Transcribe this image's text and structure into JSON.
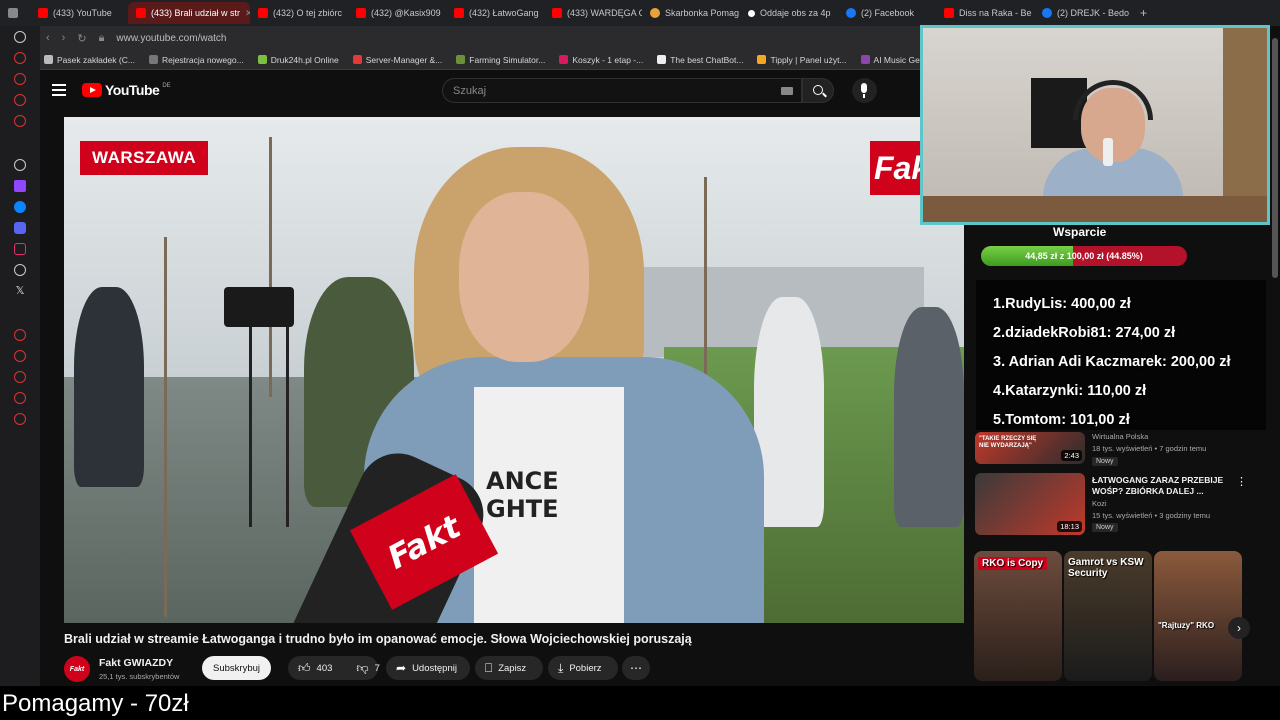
{
  "browser": {
    "tabs": [
      {
        "label": "(433) YouTube",
        "icon": "youtube-icon"
      },
      {
        "label": "(433) Brali udział w str",
        "icon": "youtube-icon",
        "active": true
      },
      {
        "label": "(432) O tej zbiórc",
        "icon": "youtube-icon"
      },
      {
        "label": "(432) @Kasix909",
        "icon": "youtube-icon"
      },
      {
        "label": "(432) ŁatwoGang",
        "icon": "youtube-icon"
      },
      {
        "label": "(433) WARDĘGA C",
        "icon": "youtube-icon"
      },
      {
        "label": "Skarbonka Pomag",
        "icon": "piggy-bank-icon"
      },
      {
        "label": "Oddaje obs za 4p",
        "icon": "tiktok-icon"
      },
      {
        "label": "(2) Facebook",
        "icon": "facebook-icon"
      },
      {
        "label": "Diss na Raka - Be",
        "icon": "youtube-icon"
      },
      {
        "label": "(2) DREJK - Bedo",
        "icon": "facebook-icon"
      }
    ],
    "new_tab": "+",
    "url": "www.youtube.com/watch",
    "bookmarks": [
      "Pasek zakładek (C...",
      "Rejestracja nowego...",
      "Druk24h.pl Online",
      "Server-Manager &...",
      "Farming Simulator...",
      "Koszyk - 1 etap -...",
      "The best ChatBot...",
      "Tipply | Panel użyt...",
      "AI Music Genera"
    ]
  },
  "youtube": {
    "logo_text": "YouTube",
    "country_code": "DE",
    "search_placeholder": "Szukaj"
  },
  "video": {
    "location_badge": "WARSZAWA",
    "brand_logo": "Fakt",
    "shirt_text_line1": "ANCE",
    "shirt_text_line2": "GHTE",
    "title": "Brali udział w streamie Łatwoganga i trudno było im opanować emocje. Słowa Wojciechowskiej poruszają",
    "channel_avatar_text": "Fakt",
    "channel_name": "Fakt GWIAZDY",
    "channel_subs": "25,1 tys. subskrybentów",
    "subscribe_label": "Subskrybuj",
    "likes": "403",
    "dislikes": "7",
    "share_label": "Udostępnij",
    "save_label": "Zapisz",
    "download_label": "Pobierz"
  },
  "recommendations": [
    {
      "title": "\"TAKIE RZECZY SIĘ NIE WYDARZAJĄ\"",
      "channel": "Wirtualna Polska",
      "stats": "18 tys. wyświetleń • 7 godzin temu",
      "duration": "2:43",
      "badge": "Nowy"
    },
    {
      "title": "ŁATWOGANG ZARAZ PRZEBIJE WOŚP? ZBIÓRKA DALEJ ...",
      "channel": "Kozi",
      "stats": "15 tys. wyświetleń • 3 godziny temu",
      "duration": "18:13",
      "badge": "Nowy"
    }
  ],
  "shorts": [
    {
      "label": "RKO is Copy"
    },
    {
      "label": "Gamrot vs KSW Security"
    },
    {
      "label": "\"Rajtuzy\" RKO"
    }
  ],
  "stream_overlay": {
    "goal_title": "Wsparcie",
    "goal_text": "44,85 zł z 100,00 zł (44.85%)",
    "goal_fraction": 0.4485,
    "leaderboard": [
      "1.RudyLis: 400,00 zł",
      "2.dziadekRobi81: 274,00 zł",
      "3. Adrian Adi Kaczmarek: 200,00 zł",
      "4.Katarzynki: 110,00 zł",
      "5.Tomtom: 101,00 zł"
    ],
    "ticker": "Pomagamy - 70zł"
  }
}
